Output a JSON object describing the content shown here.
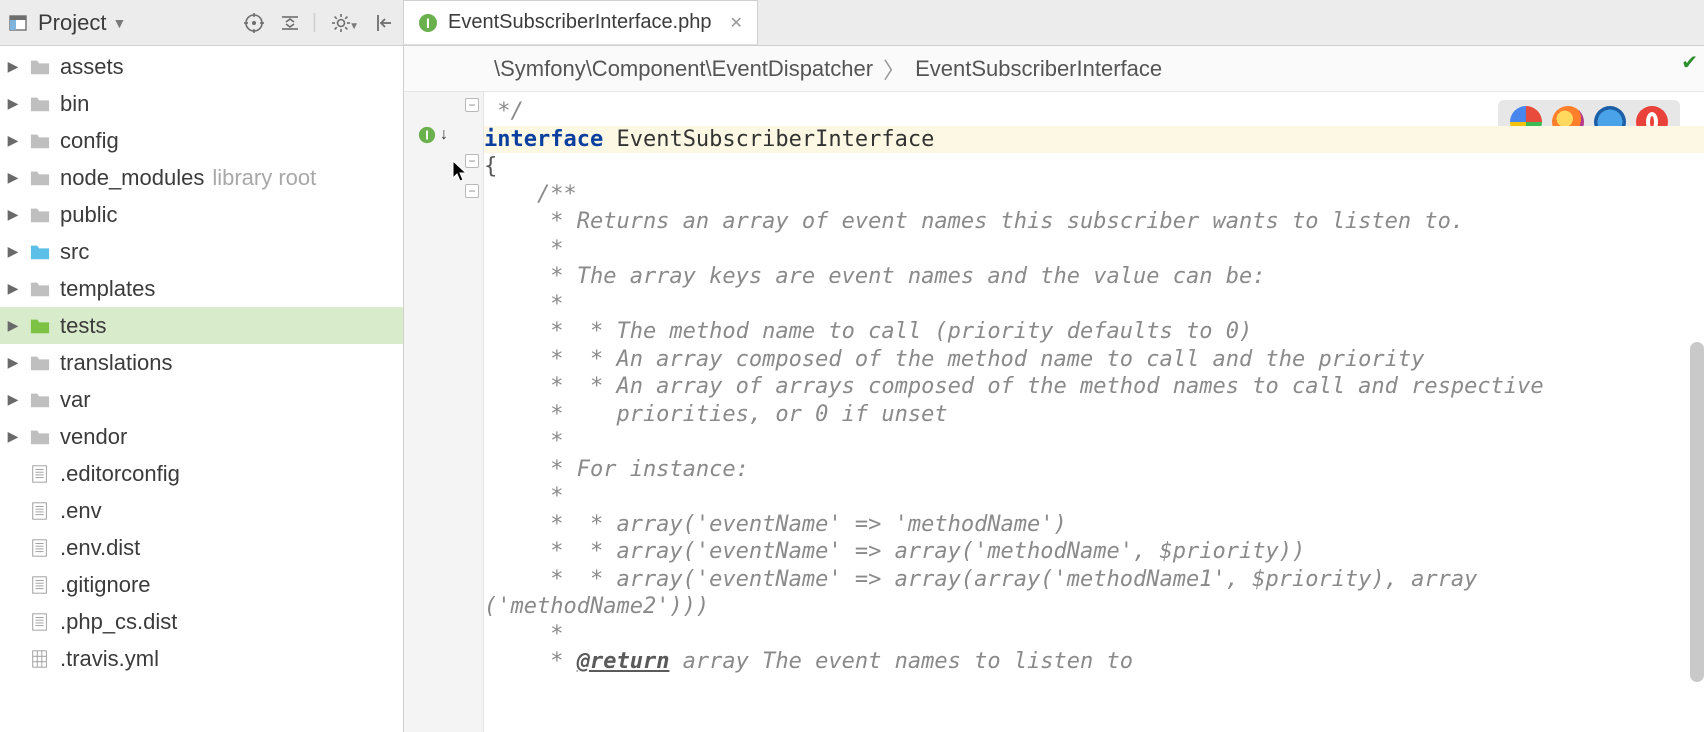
{
  "project_header": {
    "title": "Project"
  },
  "tab": {
    "filename": "EventSubscriberInterface.php"
  },
  "breadcrumb": {
    "a": "\\Symfony\\Component\\EventDispatcher",
    "b": "EventSubscriberInterface"
  },
  "tree": [
    {
      "name": "assets",
      "kind": "folder",
      "expandable": true
    },
    {
      "name": "bin",
      "kind": "folder",
      "expandable": true
    },
    {
      "name": "config",
      "kind": "folder",
      "expandable": true
    },
    {
      "name": "node_modules",
      "kind": "folder",
      "expandable": true,
      "hint": "library root"
    },
    {
      "name": "public",
      "kind": "folder",
      "expandable": true
    },
    {
      "name": "src",
      "kind": "folder-src",
      "expandable": true
    },
    {
      "name": "templates",
      "kind": "folder",
      "expandable": true
    },
    {
      "name": "tests",
      "kind": "folder-tests",
      "expandable": true,
      "selected": true
    },
    {
      "name": "translations",
      "kind": "folder",
      "expandable": true
    },
    {
      "name": "var",
      "kind": "folder",
      "expandable": true
    },
    {
      "name": "vendor",
      "kind": "folder",
      "expandable": true
    },
    {
      "name": ".editorconfig",
      "kind": "file",
      "expandable": false
    },
    {
      "name": ".env",
      "kind": "file",
      "expandable": false
    },
    {
      "name": ".env.dist",
      "kind": "file",
      "expandable": false
    },
    {
      "name": ".gitignore",
      "kind": "file",
      "expandable": false
    },
    {
      "name": ".php_cs.dist",
      "kind": "file",
      "expandable": false
    },
    {
      "name": ".travis.yml",
      "kind": "file-grid",
      "expandable": false
    }
  ],
  "code": {
    "l0": " */",
    "kw": "interface",
    "name": " EventSubscriberInterface",
    "l2": "{",
    "l3": "    /**",
    "l4": "     * Returns an array of event names this subscriber wants to listen to.",
    "l5": "     *",
    "l6": "     * The array keys are event names and the value can be:",
    "l7": "     *",
    "l8": "     *  * The method name to call (priority defaults to 0)",
    "l9": "     *  * An array composed of the method name to call and the priority",
    "l10": "     *  * An array of arrays composed of the method names to call and respective",
    "l11": "     *    priorities, or 0 if unset",
    "l12": "     *",
    "l13": "     * For instance:",
    "l14": "     *",
    "l15": "     *  * array('eventName' => 'methodName')",
    "l16": "     *  * array('eventName' => array('methodName', $priority))",
    "l17": "     *  * array('eventName' => array(array('methodName1', $priority), array",
    "l18": "('methodName2')))",
    "l19": "     *",
    "l20a": "     * ",
    "l20tag": "@return",
    "l20b": " array The event names to listen to"
  }
}
